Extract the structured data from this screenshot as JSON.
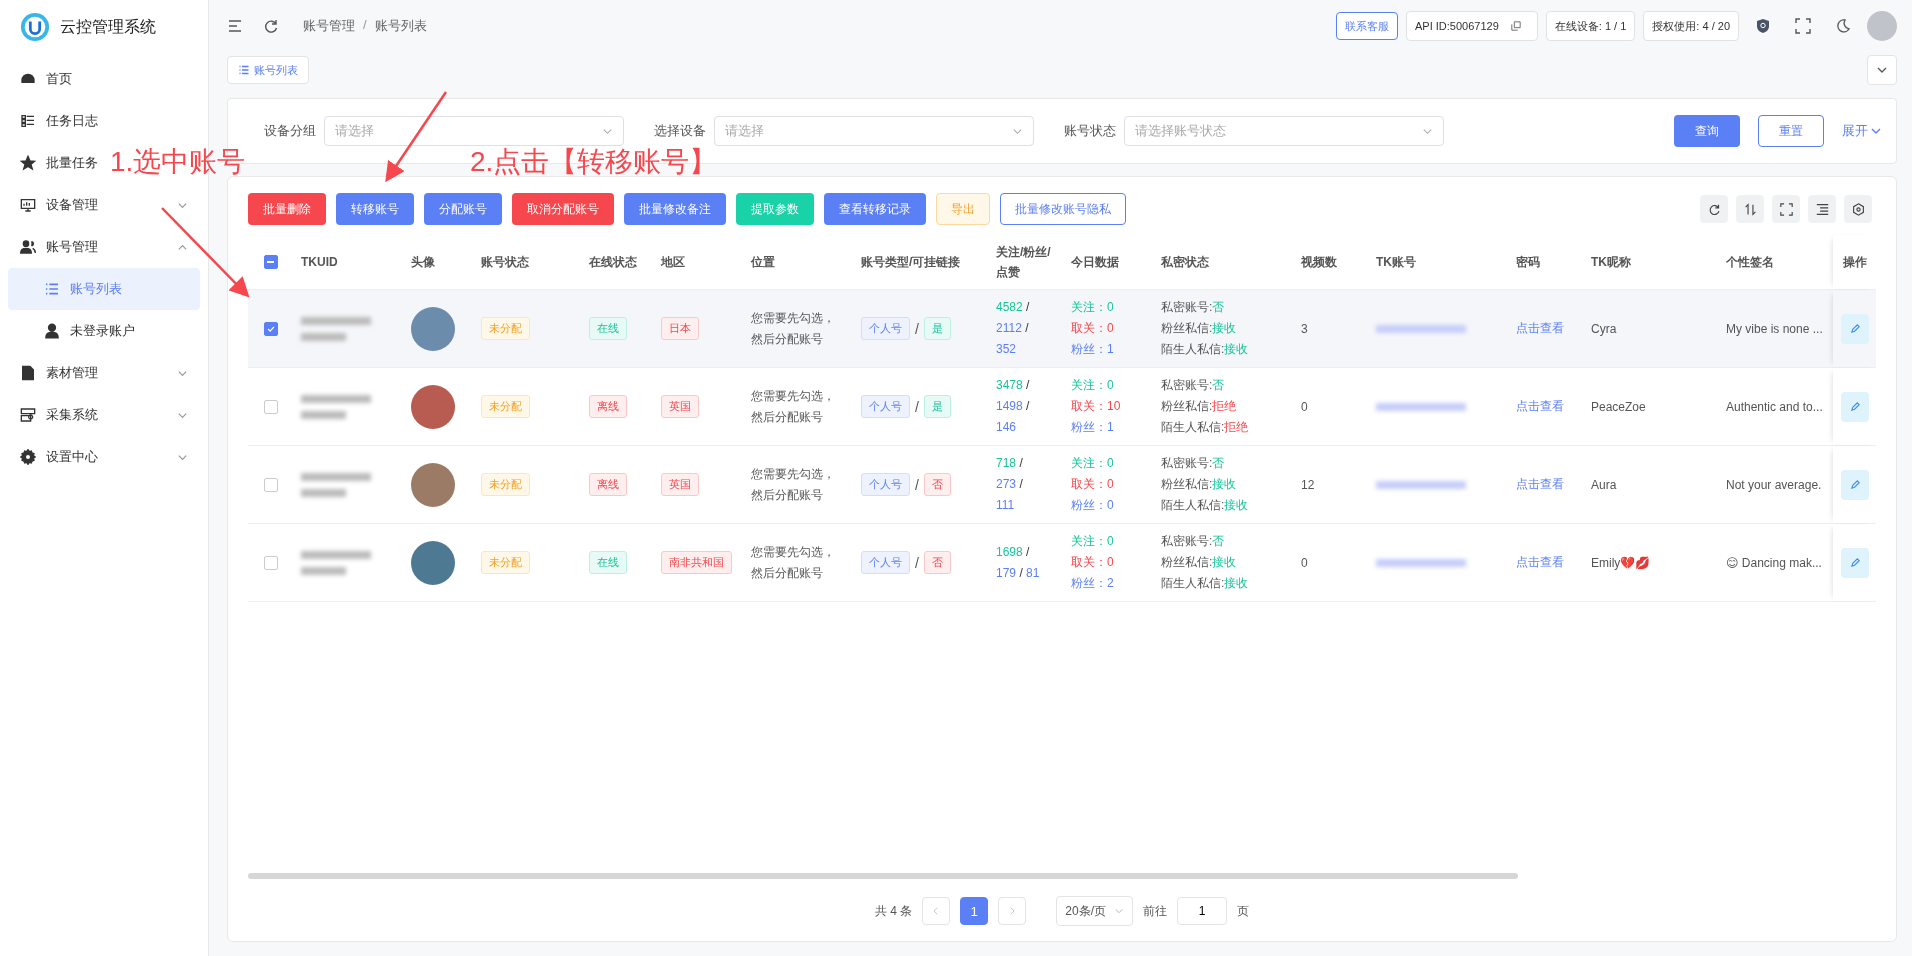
{
  "app": {
    "title": "云控管理系统"
  },
  "sidebar": {
    "items": [
      {
        "label": "首页",
        "expandable": false
      },
      {
        "label": "任务日志",
        "expandable": false
      },
      {
        "label": "批量任务",
        "expandable": false
      },
      {
        "label": "设备管理",
        "expandable": true,
        "expanded": false
      },
      {
        "label": "账号管理",
        "expandable": true,
        "expanded": true,
        "children": [
          {
            "label": "账号列表",
            "selected": true
          },
          {
            "label": "未登录账户",
            "selected": false
          }
        ]
      },
      {
        "label": "素材管理",
        "expandable": true,
        "expanded": false
      },
      {
        "label": "采集系统",
        "expandable": true,
        "expanded": false
      },
      {
        "label": "设置中心",
        "expandable": true,
        "expanded": false
      }
    ]
  },
  "header": {
    "breadcrumb": [
      "账号管理",
      "账号列表"
    ],
    "breadcrumb_separator": "/",
    "support": "联系客服",
    "api_id": "API ID:50067129",
    "online_devices": "在线设备: 1 / 1",
    "license": "授权使用: 4 / 20"
  },
  "tabs": [
    {
      "label": "账号列表",
      "selected": true
    }
  ],
  "filters": {
    "fields": [
      {
        "label": "设备分组",
        "placeholder": "请选择"
      },
      {
        "label": "选择设备",
        "placeholder": "请选择"
      },
      {
        "label": "账号状态",
        "placeholder": "请选择账号状态"
      }
    ],
    "query": "查询",
    "reset": "重置",
    "expand": "展开"
  },
  "toolbar": [
    {
      "kind": "danger",
      "label": "批量删除"
    },
    {
      "kind": "primary",
      "label": "转移账号"
    },
    {
      "kind": "primary",
      "label": "分配账号"
    },
    {
      "kind": "danger",
      "label": "取消分配账号"
    },
    {
      "kind": "primary",
      "label": "批量修改备注"
    },
    {
      "kind": "success",
      "label": "提取参数"
    },
    {
      "kind": "primary",
      "label": "查看转移记录"
    },
    {
      "kind": "warning-plain",
      "label": "导出"
    },
    {
      "kind": "primary-plain",
      "label": "批量修改账号隐私"
    }
  ],
  "table": {
    "header_checkbox": {
      "indeterminate": true
    },
    "columns": [
      "TKUID",
      "头像",
      "账号状态",
      "在线状态",
      "地区",
      "位置",
      "账号类型/可挂链接",
      "关注/粉丝/点赞",
      "今日数据",
      "私密状态",
      "视频数",
      "TK账号",
      "密码",
      "TK昵称",
      "个性签名",
      "操作"
    ],
    "rows": [
      {
        "selected": true,
        "account_status": "未分配",
        "online": {
          "text": "在线",
          "on": true
        },
        "region": "日本",
        "location": "您需要先勾选，然后分配账号",
        "account_type": "个人号",
        "type_separator": "/",
        "linkable": {
          "text": "是",
          "on": true
        },
        "stats": [
          {
            "kind": "follow",
            "text": "4582"
          },
          {
            "kind": "sep",
            "text": "/"
          },
          {
            "kind": "fans",
            "text": "2112"
          },
          {
            "kind": "sep",
            "text": "/"
          },
          {
            "kind": "likes",
            "text": "352"
          }
        ],
        "today": [
          {
            "kind": "follow",
            "text": "关注：0"
          },
          {
            "kind": "unfollow",
            "text": "取关：0"
          },
          {
            "kind": "fans",
            "text": "粉丝：1"
          }
        ],
        "privacy": [
          {
            "label": "私密账号:",
            "value": "否",
            "positive": true
          },
          {
            "label": "粉丝私信:",
            "value": "接收",
            "positive": true
          },
          {
            "label": "陌生人私信:",
            "value": "接收",
            "positive": true
          }
        ],
        "videos": "3",
        "password": "点击查看",
        "nickname": "Cyra",
        "signature": "My vibe is none ..."
      },
      {
        "selected": false,
        "account_status": "未分配",
        "online": {
          "text": "离线",
          "on": false
        },
        "region": "英国",
        "location": "您需要先勾选，然后分配账号",
        "account_type": "个人号",
        "type_separator": "/",
        "linkable": {
          "text": "是",
          "on": true
        },
        "stats": [
          {
            "kind": "follow",
            "text": "3478"
          },
          {
            "kind": "sep",
            "text": "/"
          },
          {
            "kind": "fans",
            "text": "1498"
          },
          {
            "kind": "sep",
            "text": "/"
          },
          {
            "kind": "likes",
            "text": "146"
          }
        ],
        "today": [
          {
            "kind": "follow",
            "text": "关注：0"
          },
          {
            "kind": "unfollow",
            "text": "取关：10"
          },
          {
            "kind": "fans",
            "text": "粉丝：1"
          }
        ],
        "privacy": [
          {
            "label": "私密账号:",
            "value": "否",
            "positive": true
          },
          {
            "label": "粉丝私信:",
            "value": "拒绝",
            "positive": false
          },
          {
            "label": "陌生人私信:",
            "value": "拒绝",
            "positive": false
          }
        ],
        "videos": "0",
        "password": "点击查看",
        "nickname": "PeaceZoe",
        "signature": "Authentic and to..."
      },
      {
        "selected": false,
        "account_status": "未分配",
        "online": {
          "text": "离线",
          "on": false
        },
        "region": "英国",
        "location": "您需要先勾选，然后分配账号",
        "account_type": "个人号",
        "type_separator": "/",
        "linkable": {
          "text": "否",
          "on": false
        },
        "stats": [
          {
            "kind": "follow",
            "text": "718"
          },
          {
            "kind": "sep",
            "text": "/"
          },
          {
            "kind": "fans",
            "text": "273"
          },
          {
            "kind": "sep",
            "text": "/"
          },
          {
            "kind": "likes",
            "text": "111"
          }
        ],
        "today": [
          {
            "kind": "follow",
            "text": "关注：0"
          },
          {
            "kind": "unfollow",
            "text": "取关：0"
          },
          {
            "kind": "fans",
            "text": "粉丝：0"
          }
        ],
        "privacy": [
          {
            "label": "私密账号:",
            "value": "否",
            "positive": true
          },
          {
            "label": "粉丝私信:",
            "value": "接收",
            "positive": true
          },
          {
            "label": "陌生人私信:",
            "value": "接收",
            "positive": true
          }
        ],
        "videos": "12",
        "password": "点击查看",
        "nickname": "Aura",
        "signature": "Not your average."
      },
      {
        "selected": false,
        "account_status": "未分配",
        "online": {
          "text": "在线",
          "on": true
        },
        "region": "南非共和国",
        "location": "您需要先勾选，然后分配账号",
        "account_type": "个人号",
        "type_separator": "/",
        "linkable": {
          "text": "否",
          "on": false
        },
        "stats": [
          {
            "kind": "follow",
            "text": "1698"
          },
          {
            "kind": "sep",
            "text": "/"
          },
          {
            "kind": "fans",
            "text": "179"
          },
          {
            "kind": "sep",
            "text": "/"
          },
          {
            "kind": "likes",
            "text": "81"
          }
        ],
        "today": [
          {
            "kind": "follow",
            "text": "关注：0"
          },
          {
            "kind": "unfollow",
            "text": "取关：0"
          },
          {
            "kind": "fans",
            "text": "粉丝：2"
          }
        ],
        "privacy": [
          {
            "label": "私密账号:",
            "value": "否",
            "positive": true
          },
          {
            "label": "粉丝私信:",
            "value": "接收",
            "positive": true
          },
          {
            "label": "陌生人私信:",
            "value": "接收",
            "positive": true
          }
        ],
        "videos": "0",
        "password": "点击查看",
        "nickname": "Emily💔💋",
        "signature": "😊 Dancing mak..."
      }
    ]
  },
  "pagination": {
    "total": "共 4 条",
    "pages": [
      {
        "label": "1",
        "selected": true
      }
    ],
    "page_size": "20条/页",
    "goto": "前往",
    "page_value": "1",
    "page_unit": "页"
  },
  "annotations": [
    {
      "text": "1.选中账号"
    },
    {
      "text": "2.点击【转移账号】"
    }
  ]
}
